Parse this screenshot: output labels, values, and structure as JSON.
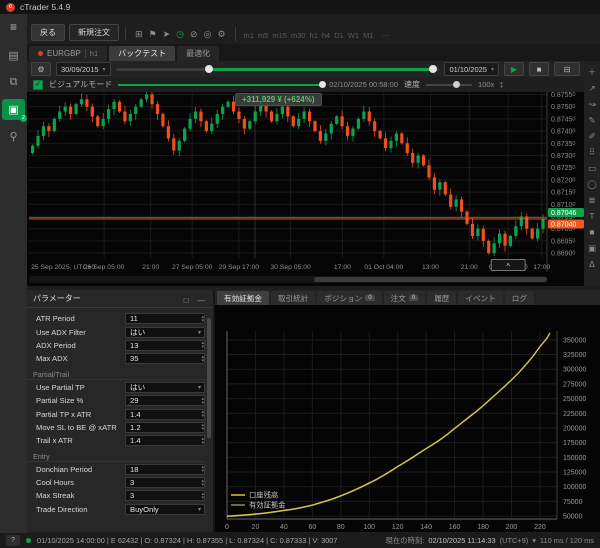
{
  "window": {
    "title": "cTrader 5.4.9",
    "logo_letter": "c"
  },
  "sidebar": {
    "menu_glyph": "≡",
    "items": [
      {
        "name": "trade",
        "glyph": "▤",
        "active": false,
        "badge": ""
      },
      {
        "name": "copy",
        "glyph": "⧉",
        "active": false,
        "badge": ""
      },
      {
        "name": "automate",
        "glyph": "▣",
        "active": true,
        "badge": "2"
      },
      {
        "name": "analyze",
        "glyph": "⚲",
        "active": false,
        "badge": ""
      }
    ]
  },
  "toolbar": {
    "back": "戻る",
    "new_order": "新規注文",
    "icons": [
      {
        "name": "layout-icon",
        "glyph": "⊞",
        "green": false
      },
      {
        "name": "pin-icon",
        "glyph": "⚑",
        "green": false
      },
      {
        "name": "pointer-icon",
        "glyph": "➤",
        "green": false
      },
      {
        "name": "replay-icon",
        "glyph": "◷",
        "green": true
      },
      {
        "name": "link-icon",
        "glyph": "⊘",
        "green": false
      },
      {
        "name": "watchlist-icon",
        "glyph": "◎",
        "green": false
      },
      {
        "name": "settings-icon",
        "glyph": "⚙",
        "green": false
      }
    ],
    "timeframes": [
      "m1",
      "m5",
      "m15",
      "m30",
      "h1",
      "h4",
      "D1",
      "W1",
      "M1"
    ],
    "more": "⋯"
  },
  "tabs": [
    {
      "type": "symbol",
      "label": "EURGBP",
      "sub": "h1",
      "active": false
    },
    {
      "type": "plain",
      "label": "バックテスト",
      "sub": "",
      "active": true
    },
    {
      "type": "plain",
      "label": "最適化",
      "sub": "",
      "active": false
    }
  ],
  "backtest": {
    "settings_icon": "⚙",
    "start_date": "30/09/2015",
    "end_date": "01/10/2025",
    "range_start": 0.29,
    "range_end": 0.98,
    "play_icon": "▶",
    "stop_icon": "■",
    "dock_icon": "⊟",
    "caret": "▾",
    "visual": {
      "label": "ビジュアルモード",
      "checked": "✓",
      "time": "02/10/2025 00:58:00",
      "speed_label": "速度",
      "speed_value": "100x",
      "stepper_up": "▴",
      "stepper_down": "▾"
    }
  },
  "right_tools": [
    {
      "name": "crosshair-tool",
      "glyph": "＋"
    },
    {
      "name": "trendline-tool",
      "glyph": "↗"
    },
    {
      "name": "ray-tool",
      "glyph": "↝"
    },
    {
      "name": "pencil-tool",
      "glyph": "✎"
    },
    {
      "name": "brush-tool",
      "glyph": "✐"
    },
    {
      "name": "pattern-tool",
      "glyph": "⠿"
    },
    {
      "name": "rectangle-tool",
      "glyph": "▭"
    },
    {
      "name": "ellipse-tool",
      "glyph": "◯"
    },
    {
      "name": "fibonacci-tool",
      "glyph": "≣"
    },
    {
      "name": "text-tool",
      "glyph": "T"
    },
    {
      "name": "shape-tool",
      "glyph": "■"
    },
    {
      "name": "snapshot-tool",
      "glyph": "▣"
    },
    {
      "name": "alert-tool",
      "glyph": "Δ"
    }
  ],
  "parameters_panel": {
    "title": "パラメーター",
    "popout_icon": "□",
    "collapse_icon": "—",
    "rows": [
      {
        "label": "ATR Period",
        "value": "11",
        "type": "stepper"
      },
      {
        "label": "Use ADX Filter",
        "value": "はい",
        "type": "select"
      },
      {
        "label": "ADX Period",
        "value": "13",
        "type": "stepper"
      },
      {
        "label": "Max ADX",
        "value": "35",
        "type": "stepper"
      },
      {
        "section": "Partial/Trail"
      },
      {
        "label": "Use Partial TP",
        "value": "はい",
        "type": "select"
      },
      {
        "label": "Partial Size %",
        "value": "29",
        "type": "stepper"
      },
      {
        "label": "Partial TP x ATR",
        "value": "1.4",
        "type": "stepper"
      },
      {
        "label": "Move SL to BE @ xATR",
        "value": "1.2",
        "type": "stepper"
      },
      {
        "label": "Trail x ATR",
        "value": "1.4",
        "type": "stepper"
      },
      {
        "section": "Entry"
      },
      {
        "label": "Donchian Period",
        "value": "18",
        "type": "stepper"
      },
      {
        "label": "Cool Hours",
        "value": "3",
        "type": "stepper"
      },
      {
        "label": "Max Streak",
        "value": "3",
        "type": "stepper"
      },
      {
        "label": "Trade Direction",
        "value": "BuyOnly",
        "type": "select"
      }
    ]
  },
  "results_panel": {
    "tabs": [
      {
        "label": "有効証拠金",
        "badge": "",
        "active": true
      },
      {
        "label": "取引統計",
        "badge": "",
        "active": false
      },
      {
        "label": "ポジション",
        "badge": "0",
        "active": false
      },
      {
        "label": "注文",
        "badge": "0",
        "active": false
      },
      {
        "label": "履歴",
        "badge": "",
        "active": false
      },
      {
        "label": "イベント",
        "badge": "",
        "active": false
      },
      {
        "label": "ログ",
        "badge": "",
        "active": false
      }
    ]
  },
  "status_bar": {
    "help": "?",
    "bar_info": "01/10/2025 14:00:00  |  E 62432  |  O: 0.87324  |  H: 0.87355  |  L: 0.87324  |  C: 0.87333  |  V: 3007",
    "clock_label": "現在の時刻:",
    "clock": "02/10/2025 11:14:33",
    "tz": "(UTC+9)",
    "caret": "▾",
    "latency": "110 ms / 120 ms"
  },
  "chart_data": [
    {
      "type": "candlestick",
      "symbol": "EURGBP",
      "timeframe": "h1",
      "tooltip": "+311,929 ¥ (+624%)",
      "marker": "^",
      "marker_f": 0.925,
      "price_top": 0.8756,
      "price_span": 0.0068,
      "ask": 0.87046,
      "bid": 0.8704,
      "ask_label": "0.87046",
      "bid_label": "0.87040",
      "bull_color": "#0fa24d",
      "bear_color": "#f0501e",
      "y_ticks": [
        0.8755,
        0.875,
        0.8745,
        0.874,
        0.8735,
        0.873,
        0.8725,
        0.872,
        0.8715,
        0.871,
        0.8705,
        0.87,
        0.8695,
        0.869
      ],
      "x_ticks": [
        {
          "label": "25 Sep 2025, UTC+0",
          "f": 0.004,
          "align": "start"
        },
        {
          "label": "26 Sep 05:00",
          "f": 0.145,
          "align": "middle"
        },
        {
          "label": "21:00",
          "f": 0.235,
          "align": "middle"
        },
        {
          "label": "27 Sep 05:00",
          "f": 0.315,
          "align": "middle"
        },
        {
          "label": "29 Sep 17:00",
          "f": 0.405,
          "align": "middle"
        },
        {
          "label": "30 Sep 05:00",
          "f": 0.505,
          "align": "middle"
        },
        {
          "label": "17:00",
          "f": 0.605,
          "align": "middle"
        },
        {
          "label": "01 Oct 04:00",
          "f": 0.685,
          "align": "middle"
        },
        {
          "label": "13:00",
          "f": 0.775,
          "align": "middle"
        },
        {
          "label": "21:00",
          "f": 0.85,
          "align": "middle"
        },
        {
          "label": "02 Oct 05:00",
          "f": 0.925,
          "align": "middle"
        },
        {
          "label": "17:00",
          "f": 0.99,
          "align": "middle"
        }
      ],
      "first_open": 8731,
      "closes": [
        8734,
        8738,
        8742,
        8740,
        8745,
        8748,
        8750,
        8747,
        8751,
        8753,
        8750,
        8746,
        8742,
        8745,
        8749,
        8752,
        8748,
        8744,
        8747,
        8750,
        8753,
        8755,
        8751,
        8747,
        8742,
        8737,
        8732,
        8736,
        8741,
        8745,
        8748,
        8744,
        8740,
        8743,
        8747,
        8750,
        8752,
        8748,
        8745,
        8741,
        8744,
        8748,
        8751,
        8748,
        8744,
        8747,
        8750,
        8746,
        8742,
        8745,
        8748,
        8744,
        8740,
        8736,
        8739,
        8743,
        8746,
        8742,
        8738,
        8741,
        8745,
        8748,
        8744,
        8740,
        8737,
        8733,
        8736,
        8739,
        8735,
        8731,
        8727,
        8730,
        8726,
        8721,
        8716,
        8719,
        8714,
        8709,
        8712,
        8707,
        8702,
        8697,
        8700,
        8695,
        8690,
        8694,
        8698,
        8693,
        8697,
        8701,
        8705,
        8700,
        8696,
        8700,
        8704
      ]
    },
    {
      "type": "line",
      "title": "有効証拠金",
      "xlim": [
        0,
        232
      ],
      "ylim": [
        45000,
        365000
      ],
      "x_ticks": [
        0,
        20,
        40,
        60,
        80,
        100,
        120,
        140,
        160,
        180,
        200,
        220
      ],
      "y_ticks": [
        50000,
        75000,
        100000,
        125000,
        150000,
        175000,
        200000,
        225000,
        250000,
        275000,
        300000,
        325000,
        350000
      ],
      "series": [
        {
          "name": "口座残高",
          "color": "#d4c64a",
          "offset": 0
        },
        {
          "name": "有効証拠金",
          "color": "#8f8f5a",
          "offset": -900
        }
      ],
      "points": [
        [
          0,
          50000
        ],
        [
          5,
          50700
        ],
        [
          10,
          51600
        ],
        [
          15,
          52400
        ],
        [
          20,
          53600
        ],
        [
          25,
          54700
        ],
        [
          30,
          56300
        ],
        [
          35,
          57900
        ],
        [
          40,
          59800
        ],
        [
          45,
          61400
        ],
        [
          50,
          63600
        ],
        [
          55,
          66100
        ],
        [
          60,
          68900
        ],
        [
          65,
          72400
        ],
        [
          70,
          76100
        ],
        [
          75,
          80000
        ],
        [
          80,
          84600
        ],
        [
          85,
          89400
        ],
        [
          90,
          94800
        ],
        [
          95,
          100300
        ],
        [
          100,
          106200
        ],
        [
          105,
          112500
        ],
        [
          110,
          119400
        ],
        [
          115,
          126800
        ],
        [
          120,
          134600
        ],
        [
          125,
          141700
        ],
        [
          130,
          149300
        ],
        [
          135,
          157200
        ],
        [
          140,
          165000
        ],
        [
          145,
          172600
        ],
        [
          150,
          180700
        ],
        [
          155,
          189500
        ],
        [
          160,
          199200
        ],
        [
          165,
          209000
        ],
        [
          170,
          218300
        ],
        [
          175,
          227800
        ],
        [
          180,
          237900
        ],
        [
          185,
          248600
        ],
        [
          190,
          259800
        ],
        [
          195,
          270600
        ],
        [
          200,
          281900
        ],
        [
          205,
          294000
        ],
        [
          210,
          307500
        ],
        [
          215,
          322000
        ],
        [
          220,
          338500
        ],
        [
          225,
          353000
        ],
        [
          227,
          361929
        ]
      ]
    }
  ]
}
